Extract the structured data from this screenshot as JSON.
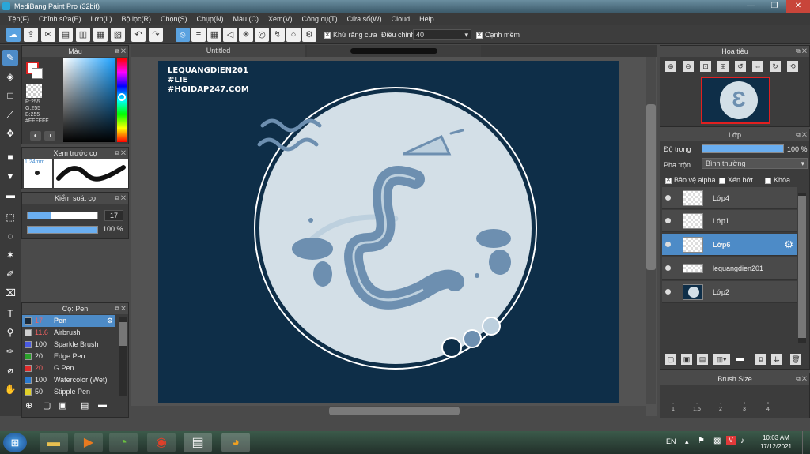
{
  "window": {
    "title": "MediBang Paint Pro (32bit)",
    "controls": [
      "—",
      "❐",
      "✕"
    ]
  },
  "menu": [
    "Tệp(F)",
    "Chỉnh sửa(E)",
    "Lớp(L)",
    "Bộ lọc(R)",
    "Chọn(S)",
    "Chụp(N)",
    "Màu (C)",
    "Xem(V)",
    "Công cụ(T)",
    "Cửa sổ(W)",
    "Cloud",
    "Help"
  ],
  "toolbar": {
    "antialias_label": "Khử răng cưa",
    "adjust_label": "Điều chỉnh",
    "adjust_value": "40",
    "sharp_label": "Cạnh mềm"
  },
  "color_panel": {
    "title": "Màu",
    "rgb_r": "R:255",
    "rgb_g": "G:255",
    "rgb_b": "B:255",
    "hex": "#FFFFFF"
  },
  "brush_preview": {
    "title": "Xem trước cọ",
    "size": "1.24mm"
  },
  "brush_control": {
    "title": "Kiểm soát cọ",
    "size": "17",
    "opacity": "100 %"
  },
  "brush_list": {
    "title": "Cọ: Pen",
    "items": [
      {
        "size": "17",
        "name": "Pen",
        "color": "#1a2a3a"
      },
      {
        "size": "11.6",
        "name": "Airbrush",
        "color": "#cfcfcf"
      },
      {
        "size": "100",
        "name": "Sparkle Brush",
        "color": "#4a5ae0"
      },
      {
        "size": "20",
        "name": "Edge Pen",
        "color": "#2aa02a"
      },
      {
        "size": "20",
        "name": "G Pen",
        "color": "#e02a2a"
      },
      {
        "size": "100",
        "name": "Watercolor (Wet)",
        "color": "#2a7ad0"
      },
      {
        "size": "50",
        "name": "Stipple Pen",
        "color": "#e0d02a"
      }
    ]
  },
  "document": {
    "tab": "Untitled"
  },
  "artwork": {
    "lines": [
      "LEQUANGDIEN201",
      "#LIE",
      "#HOIDAP247.COM"
    ],
    "letter": "Ɛ",
    "accent": "#6d8fb0",
    "background": "#0e2e48",
    "disc": "#c8d6e0"
  },
  "navigator": {
    "title": "Hoa tiêu"
  },
  "layers_panel": {
    "title": "Lớp",
    "opacity_label": "Độ trong",
    "opacity_value": "100 %",
    "blend_label": "Pha trộn",
    "blend_value": "Bình thường",
    "protect_alpha": "Bảo vệ alpha",
    "clip": "Xén bớt",
    "lock": "Khóa",
    "layers": [
      {
        "name": "Lớp4"
      },
      {
        "name": "Lớp1"
      },
      {
        "name": "Lớp6"
      },
      {
        "name": "lequangdien201"
      },
      {
        "name": "Lớp2"
      }
    ]
  },
  "brush_size": {
    "title": "Brush Size",
    "sizes": [
      "1",
      "1.5",
      "2",
      "3",
      "4"
    ]
  },
  "taskbar": {
    "lang": "EN",
    "time": "10:03 AM",
    "date": "17/12/2021"
  }
}
